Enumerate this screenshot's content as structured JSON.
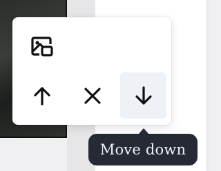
{
  "toolbar": {
    "replace_icon": "replace-image-icon",
    "move_up_icon": "arrow-up-icon",
    "remove_icon": "close-icon",
    "move_down_icon": "arrow-down-icon",
    "active_button": "move-down"
  },
  "tooltip": {
    "text": "Move down"
  },
  "colors": {
    "tooltip_bg": "#262a35",
    "tooltip_text": "#eef0f5",
    "active_button_bg": "#eef1f5",
    "icon": "#111111"
  }
}
